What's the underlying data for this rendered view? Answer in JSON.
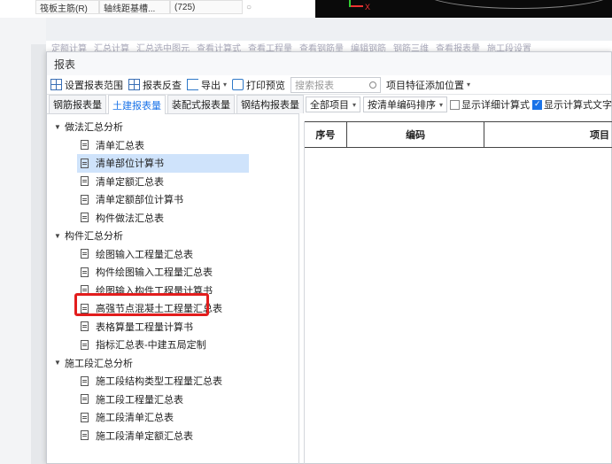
{
  "background": {
    "row_label": "筏板主筋(R)",
    "row_value1": "轴线距基槽...",
    "row_value2": "(725)",
    "axis_label": "X",
    "tabs": [
      "定额计算",
      "汇总计算",
      "汇总选中图元",
      "查看计算式",
      "查看工程量",
      "查看钢筋量",
      "编辑钢筋",
      "钢筋三维",
      "查看报表量",
      "施工段设置"
    ]
  },
  "dialog": {
    "title": "报表",
    "toolbar": {
      "set_scope": "设置报表范围",
      "reverse_check": "报表反查",
      "export": "导出",
      "print_preview": "打印预览",
      "search_placeholder": "搜索报表",
      "feature_pos": "项目特征添加位置"
    },
    "left_tabs": [
      "钢筋报表量",
      "土建报表量",
      "装配式报表量",
      "钢结构报表量"
    ],
    "tree": [
      {
        "label": "做法汇总分析",
        "items": [
          "清单汇总表",
          "清单部位计算书",
          "清单定额汇总表",
          "清单定额部位计算书",
          "构件做法汇总表"
        ]
      },
      {
        "label": "构件汇总分析",
        "items": [
          "绘图输入工程量汇总表",
          "构件绘图输入工程量汇总表",
          "绘图输入构件工程量计算书",
          "高强节点混凝土工程量汇总表",
          "表格算量工程量计算书",
          "指标汇总表-中建五局定制"
        ]
      },
      {
        "label": "施工段汇总分析",
        "items": [
          "施工段结构类型工程量汇总表",
          "施工段工程量汇总表",
          "施工段清单汇总表",
          "施工段清单定额汇总表"
        ]
      }
    ],
    "right": {
      "filter": "全部项目",
      "sort": "按清单编码排序",
      "show_detail": "显示详细计算式",
      "show_text": "显示计算式文字说明",
      "columns": [
        "序号",
        "编码",
        "项目"
      ]
    }
  }
}
